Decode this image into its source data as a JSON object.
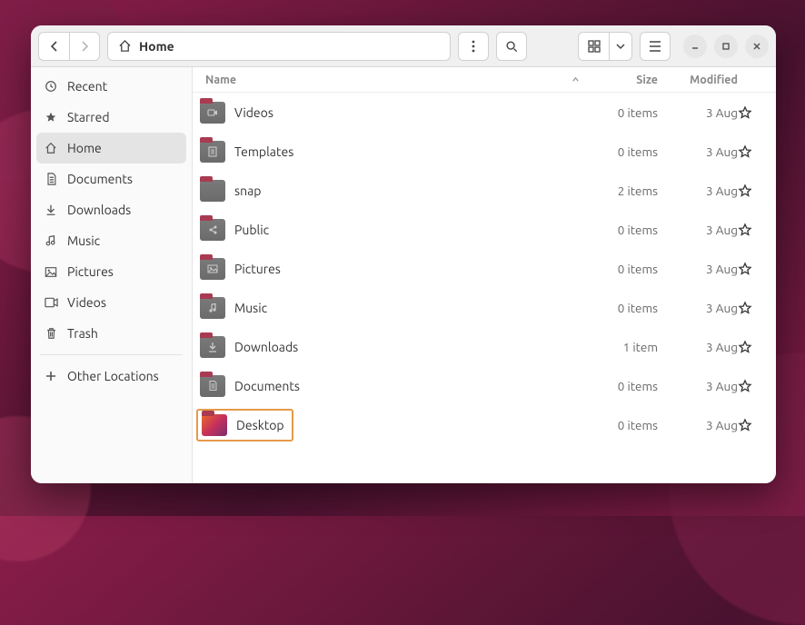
{
  "header": {
    "location_label": "Home"
  },
  "sidebar": {
    "items": [
      {
        "label": "Recent",
        "icon": "clock-icon"
      },
      {
        "label": "Starred",
        "icon": "star-icon"
      },
      {
        "label": "Home",
        "icon": "home-icon",
        "selected": true
      },
      {
        "label": "Documents",
        "icon": "document-icon"
      },
      {
        "label": "Downloads",
        "icon": "download-icon"
      },
      {
        "label": "Music",
        "icon": "music-icon"
      },
      {
        "label": "Pictures",
        "icon": "picture-icon"
      },
      {
        "label": "Videos",
        "icon": "video-icon"
      },
      {
        "label": "Trash",
        "icon": "trash-icon"
      }
    ],
    "other_locations_label": "Other Locations"
  },
  "columns": {
    "name": "Name",
    "size": "Size",
    "modified": "Modified"
  },
  "files": [
    {
      "name": "Videos",
      "size": "0 items",
      "modified": "3 Aug",
      "icon": "video",
      "selected": false
    },
    {
      "name": "Templates",
      "size": "0 items",
      "modified": "3 Aug",
      "icon": "template",
      "selected": false
    },
    {
      "name": "snap",
      "size": "2 items",
      "modified": "3 Aug",
      "icon": "folder",
      "selected": false
    },
    {
      "name": "Public",
      "size": "0 items",
      "modified": "3 Aug",
      "icon": "public",
      "selected": false
    },
    {
      "name": "Pictures",
      "size": "0 items",
      "modified": "3 Aug",
      "icon": "picture",
      "selected": false
    },
    {
      "name": "Music",
      "size": "0 items",
      "modified": "3 Aug",
      "icon": "music",
      "selected": false
    },
    {
      "name": "Downloads",
      "size": "1 item",
      "modified": "3 Aug",
      "icon": "download",
      "selected": false
    },
    {
      "name": "Documents",
      "size": "0 items",
      "modified": "3 Aug",
      "icon": "document",
      "selected": false
    },
    {
      "name": "Desktop",
      "size": "0 items",
      "modified": "3 Aug",
      "icon": "desktop",
      "selected": true
    }
  ]
}
